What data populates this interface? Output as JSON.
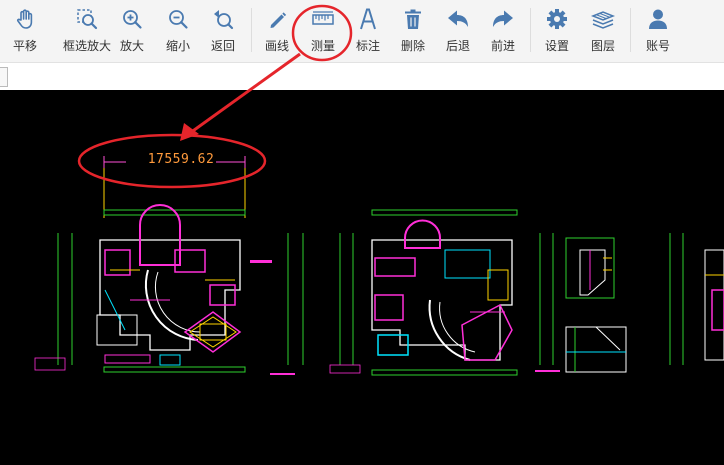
{
  "toolbar": {
    "items": [
      {
        "label": "平移",
        "icon": "pan-hand-icon"
      },
      {
        "label": "框选放大",
        "icon": "box-zoom-icon"
      },
      {
        "label": "放大",
        "icon": "zoom-in-icon"
      },
      {
        "label": "缩小",
        "icon": "zoom-out-icon"
      },
      {
        "label": "返回",
        "icon": "return-icon"
      },
      {
        "label": "画线",
        "icon": "pencil-icon"
      },
      {
        "label": "测量",
        "icon": "ruler-icon"
      },
      {
        "label": "标注",
        "icon": "text-a-icon"
      },
      {
        "label": "删除",
        "icon": "trash-icon"
      },
      {
        "label": "后退",
        "icon": "undo-arrow-icon"
      },
      {
        "label": "前进",
        "icon": "redo-arrow-icon"
      },
      {
        "label": "设置",
        "icon": "gear-icon"
      },
      {
        "label": "图层",
        "icon": "layers-icon"
      },
      {
        "label": "账号",
        "icon": "user-icon"
      }
    ],
    "active_tool": "测量"
  },
  "canvas": {
    "measurement_value": "17559.62"
  },
  "colors": {
    "icon_blue": "#4a7ab0",
    "highlight_red": "#e5252b",
    "measure_orange": "#ff9a3c",
    "canvas_bg": "#000000"
  }
}
